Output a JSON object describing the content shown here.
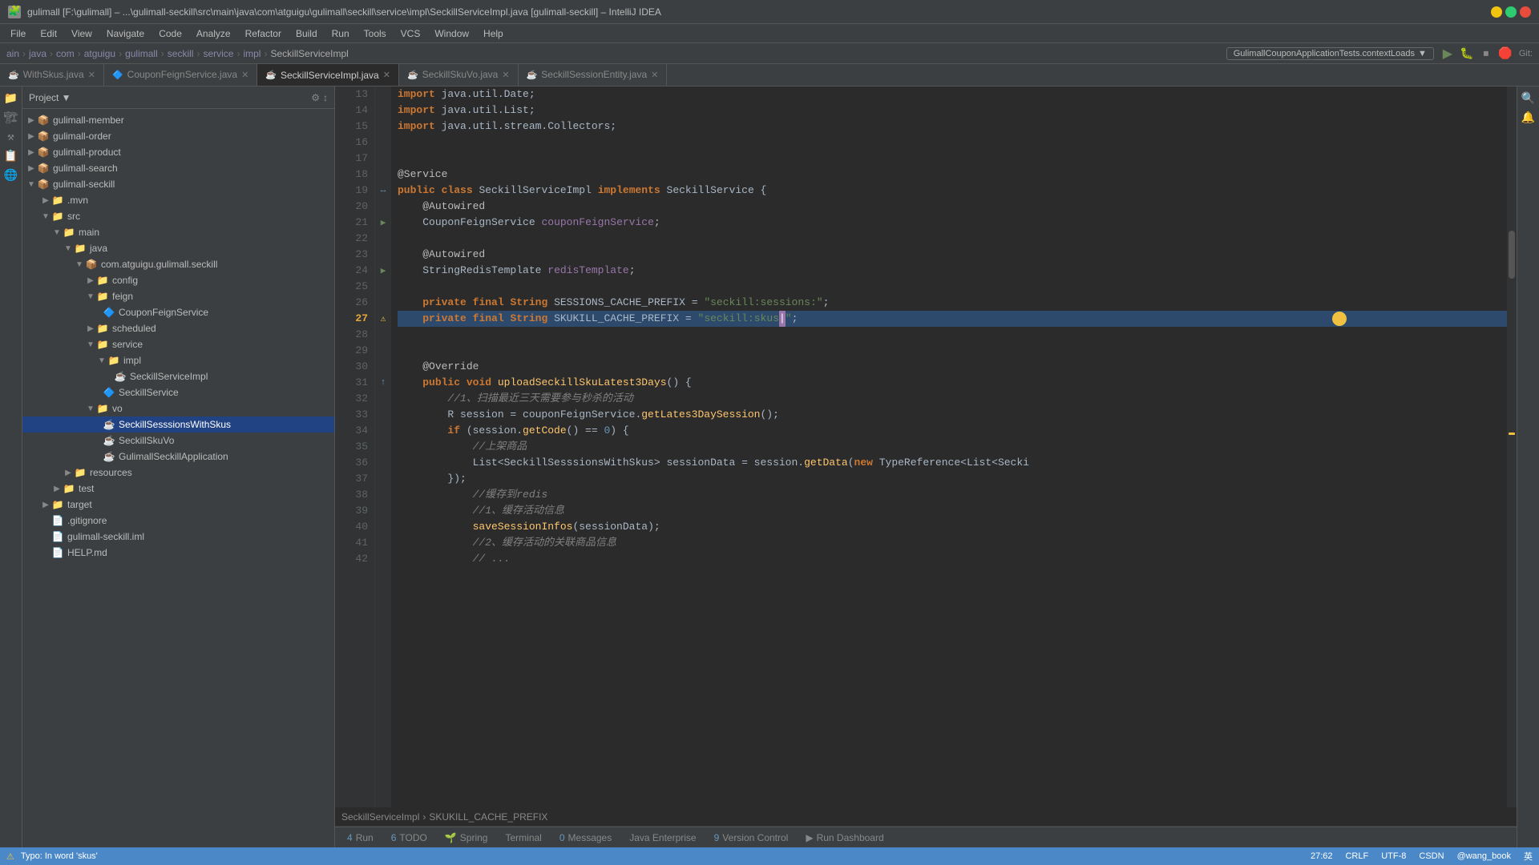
{
  "titleBar": {
    "text": "gulimall [F:\\gulimall] – ...\\gulimall-seckill\\src\\main\\java\\com\\atguigu\\gulimall\\seckill\\service\\impl\\SeckillServiceImpl.java [gulimall-seckill] – IntelliJ IDEA",
    "icon": "🧩"
  },
  "menuBar": {
    "items": [
      "File",
      "Edit",
      "View",
      "Navigate",
      "Code",
      "Analyze",
      "Refactor",
      "Build",
      "Run",
      "Tools",
      "VCS",
      "Window",
      "Help"
    ]
  },
  "breadcrumbs": [
    "ain",
    "java",
    "com",
    "atguigu",
    "gulimall",
    "seckill",
    "service",
    "impl",
    "SeckillServiceImpl"
  ],
  "tabs": [
    {
      "label": "WithSkus.java",
      "active": false,
      "modified": false
    },
    {
      "label": "CouponFeignService.java",
      "active": false,
      "modified": false
    },
    {
      "label": "SeckillServiceImpl.java",
      "active": true,
      "modified": false
    },
    {
      "label": "SeckillSkuVo.java",
      "active": false,
      "modified": false
    },
    {
      "label": "SeckillSessionEntity.java",
      "active": false,
      "modified": false
    }
  ],
  "runDropdown": "GulimallCouponApplicationTests.contextLoads",
  "projectTree": {
    "title": "Project",
    "items": [
      {
        "level": 0,
        "type": "module",
        "label": "gulimall-member",
        "expanded": false,
        "icon": "📦"
      },
      {
        "level": 0,
        "type": "module",
        "label": "gulimall-order",
        "expanded": false,
        "icon": "📦"
      },
      {
        "level": 0,
        "type": "module",
        "label": "gulimall-product",
        "expanded": false,
        "icon": "📦"
      },
      {
        "level": 0,
        "type": "module",
        "label": "gulimall-search",
        "expanded": false,
        "icon": "📦"
      },
      {
        "level": 0,
        "type": "module",
        "label": "gulimall-seckill",
        "expanded": true,
        "icon": "📦"
      },
      {
        "level": 1,
        "type": "folder",
        "label": ".mvn",
        "expanded": false,
        "icon": "📁"
      },
      {
        "level": 1,
        "type": "folder",
        "label": "src",
        "expanded": true,
        "icon": "📁"
      },
      {
        "level": 2,
        "type": "folder",
        "label": "main",
        "expanded": true,
        "icon": "📁"
      },
      {
        "level": 3,
        "type": "folder",
        "label": "java",
        "expanded": true,
        "icon": "📁"
      },
      {
        "level": 4,
        "type": "package",
        "label": "com.atguigu.gulimall.seckill",
        "expanded": true,
        "icon": "📦"
      },
      {
        "level": 5,
        "type": "folder",
        "label": "config",
        "expanded": false,
        "icon": "📁"
      },
      {
        "level": 5,
        "type": "folder",
        "label": "feign",
        "expanded": true,
        "icon": "📁"
      },
      {
        "level": 6,
        "type": "class",
        "label": "CouponFeignService",
        "icon": "🔵"
      },
      {
        "level": 5,
        "type": "folder",
        "label": "scheduled",
        "expanded": false,
        "icon": "📁"
      },
      {
        "level": 5,
        "type": "folder",
        "label": "service",
        "expanded": true,
        "icon": "📁"
      },
      {
        "level": 6,
        "type": "folder",
        "label": "impl",
        "expanded": true,
        "icon": "📁"
      },
      {
        "level": 7,
        "type": "class",
        "label": "SeckillServiceImpl",
        "icon": "🔵"
      },
      {
        "level": 6,
        "type": "interface",
        "label": "SeckillService",
        "icon": "🔷"
      },
      {
        "level": 5,
        "type": "folder",
        "label": "vo",
        "expanded": true,
        "icon": "📁"
      },
      {
        "level": 6,
        "type": "class",
        "label": "SeckillSesssionsWithSkus",
        "selected": true,
        "icon": "🔵"
      },
      {
        "level": 6,
        "type": "class",
        "label": "SeckillSkuVo",
        "icon": "🔵"
      },
      {
        "level": 6,
        "type": "class",
        "label": "GulimallSeckillApplication",
        "icon": "🔵"
      },
      {
        "level": 3,
        "type": "folder",
        "label": "resources",
        "expanded": false,
        "icon": "📁"
      },
      {
        "level": 2,
        "type": "folder",
        "label": "test",
        "expanded": false,
        "icon": "📁"
      },
      {
        "level": 1,
        "type": "folder",
        "label": "target",
        "expanded": false,
        "icon": "📁"
      },
      {
        "level": 1,
        "type": "file",
        "label": ".gitignore",
        "icon": "📄"
      },
      {
        "level": 1,
        "type": "file",
        "label": "gulimall-seckill.iml",
        "icon": "📄"
      },
      {
        "level": 1,
        "type": "file",
        "label": "HELP.md",
        "icon": "📄"
      }
    ]
  },
  "codeEditor": {
    "filename": "SeckillServiceImpl.java",
    "breadcrumbNav": "SeckillServiceImpl › SKUKILL_CACHE_PREFIX",
    "lines": [
      {
        "num": 13,
        "content": "import java.util.Date;"
      },
      {
        "num": 14,
        "content": "import java.util.List;"
      },
      {
        "num": 15,
        "content": "import java.util.stream.Collectors;"
      },
      {
        "num": 16,
        "content": ""
      },
      {
        "num": 17,
        "content": ""
      },
      {
        "num": 18,
        "content": "@Service",
        "type": "annotation"
      },
      {
        "num": 19,
        "content": "public class SeckillServiceImpl implements SeckillService {",
        "hasGutter": true
      },
      {
        "num": 20,
        "content": "    @Autowired"
      },
      {
        "num": 21,
        "content": "    CouponFeignService couponFeignService;",
        "hasGutter": true
      },
      {
        "num": 22,
        "content": ""
      },
      {
        "num": 23,
        "content": "    @Autowired"
      },
      {
        "num": 24,
        "content": "    StringRedisTemplate redisTemplate;",
        "hasGutter": true
      },
      {
        "num": 25,
        "content": ""
      },
      {
        "num": 26,
        "content": "    private final String SESSIONS_CACHE_PREFIX = \"seckill:sessions:\";"
      },
      {
        "num": 27,
        "content": "    private final String SKUKILL_CACHE_PREFIX = \"seckill:skus\";",
        "current": true,
        "hasWarning": true
      },
      {
        "num": 28,
        "content": ""
      },
      {
        "num": 29,
        "content": ""
      },
      {
        "num": 30,
        "content": "    @Override"
      },
      {
        "num": 31,
        "content": "    public void uploadSeckillSkuLatest3Days() {",
        "hasGutter": true
      },
      {
        "num": 32,
        "content": "        //1、扫描最近三天需要参与秒杀的活动"
      },
      {
        "num": 33,
        "content": "        R session = couponFeignService.getLates3DaySession();"
      },
      {
        "num": 34,
        "content": "        if (session.getCode() == 0) {"
      },
      {
        "num": 35,
        "content": "            //上架商品"
      },
      {
        "num": 36,
        "content": "            List<SeckillSesssionsWithSkus> sessionData = session.getData(new TypeReference<List<Secki"
      },
      {
        "num": 37,
        "content": "        });"
      },
      {
        "num": 38,
        "content": "            //缓存到redis"
      },
      {
        "num": 39,
        "content": "            //1、缓存活动信息"
      },
      {
        "num": 40,
        "content": "            saveSessionInfos(sessionData);"
      },
      {
        "num": 41,
        "content": "            //2、缓存活动的关联商品信息"
      },
      {
        "num": 42,
        "content": "            // ..."
      }
    ]
  },
  "bottomTabs": [
    {
      "num": "4",
      "label": "Run"
    },
    {
      "num": "6",
      "label": "TODO"
    },
    {
      "label": "Spring"
    },
    {
      "label": "Terminal"
    },
    {
      "num": "0",
      "label": "Messages"
    },
    {
      "label": "Java Enterprise"
    },
    {
      "num": "9",
      "label": "Version Control"
    },
    {
      "label": "Run Dashboard"
    }
  ],
  "statusBar": {
    "warning": "Typo: In word 'skus'",
    "position": "27:62",
    "lineEnding": "CRLF",
    "encoding": "UTF-8",
    "rightItems": [
      "英",
      "CSDN @wang_book"
    ]
  }
}
